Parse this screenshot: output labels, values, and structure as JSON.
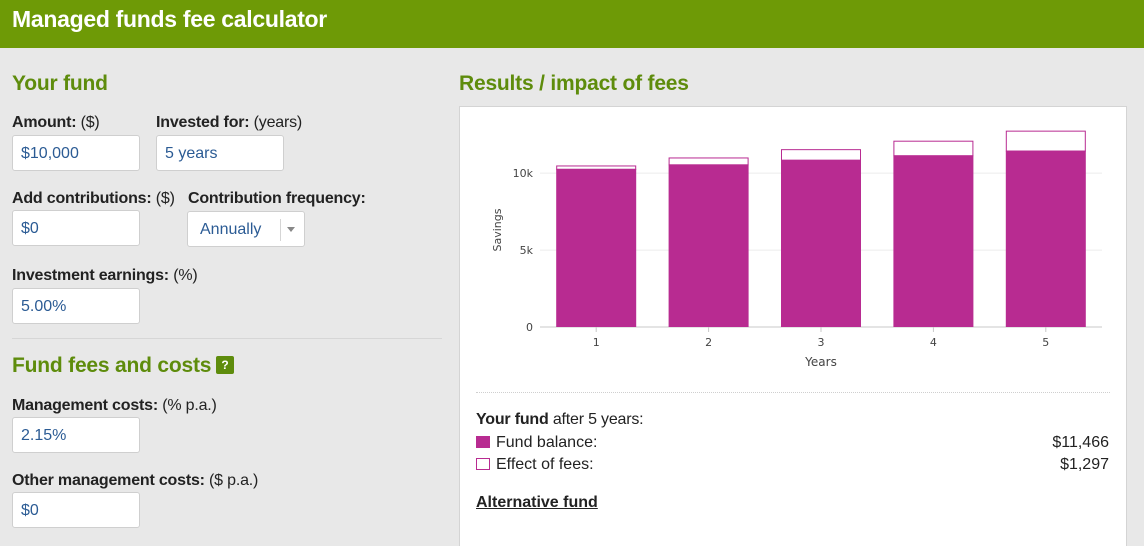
{
  "header": {
    "title": "Managed funds fee calculator"
  },
  "your_fund": {
    "title": "Your fund",
    "amount": {
      "label_bold": "Amount:",
      "label_unit": "($)",
      "value": "$10,000"
    },
    "invested_for": {
      "label_bold": "Invested for:",
      "label_unit": "(years)",
      "value": "5 years"
    },
    "contributions": {
      "label_bold": "Add contributions:",
      "label_unit": "($)",
      "value": "$0"
    },
    "frequency": {
      "label_bold": "Contribution frequency:",
      "value": "Annually"
    },
    "earnings": {
      "label_bold": "Investment earnings:",
      "label_unit": "(%)",
      "value": "5.00%"
    }
  },
  "fees": {
    "title": "Fund fees and costs",
    "help_label": "?",
    "management": {
      "label_bold": "Management costs:",
      "label_unit": "(% p.a.)",
      "value": "2.15%"
    },
    "other": {
      "label_bold": "Other management costs:",
      "label_unit": "($ p.a.)",
      "value": "$0"
    }
  },
  "results": {
    "title": "Results / impact of fees",
    "summary": {
      "prefix_bold": "Your fund",
      "suffix": "after 5 years:",
      "fund_balance_label": "Fund balance:",
      "fund_balance_value": "$11,466",
      "fees_label": "Effect of fees:",
      "fees_value": "$1,297"
    },
    "alt_link": "Alternative fund"
  },
  "colors": {
    "header": "#6e9a06",
    "section_title": "#5e8c0c",
    "balance": "#b82b91",
    "input_text": "#2b5b94"
  },
  "chart_data": {
    "type": "bar",
    "stacked": true,
    "categories": [
      "1",
      "2",
      "3",
      "4",
      "5"
    ],
    "series": [
      {
        "name": "Fund balance",
        "values": [
          10280,
          10570,
          10870,
          11160,
          11466
        ]
      },
      {
        "name": "Effect of fees",
        "values": [
          220,
          450,
          690,
          950,
          1297
        ]
      }
    ],
    "xlabel": "Years",
    "ylabel": "Savings",
    "yticks": [
      "0",
      "5k",
      "10k"
    ],
    "ytick_values": [
      0,
      5000,
      10000
    ],
    "ylim": [
      0,
      13000
    ],
    "grid": true,
    "legend": "none"
  }
}
